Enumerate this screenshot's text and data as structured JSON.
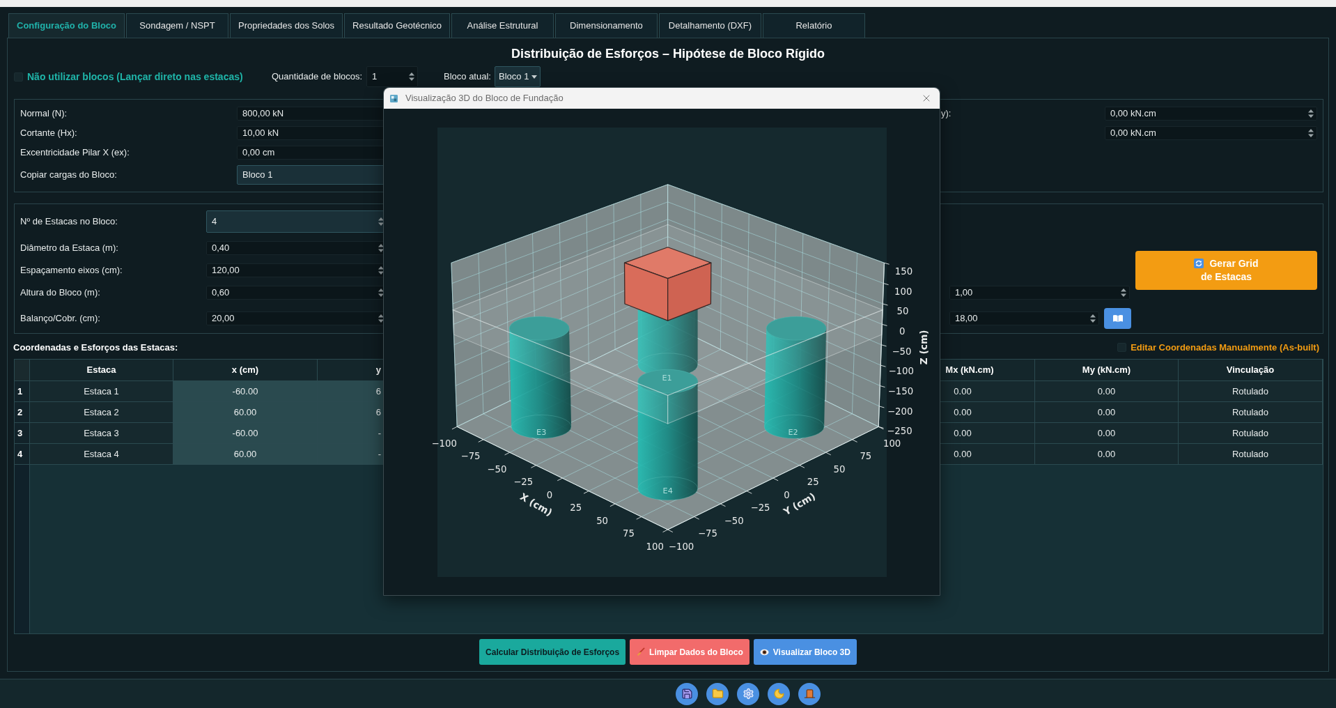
{
  "tabs": [
    {
      "label": "Configuração do Bloco",
      "selected": true
    },
    {
      "label": "Sondagem / NSPT",
      "selected": false
    },
    {
      "label": "Propriedades dos Solos",
      "selected": false
    },
    {
      "label": "Resultado Geotécnico",
      "selected": false
    },
    {
      "label": "Análise Estrutural",
      "selected": false
    },
    {
      "label": "Dimensionamento",
      "selected": false
    },
    {
      "label": "Detalhamento (DXF)",
      "selected": false
    },
    {
      "label": "Relatório",
      "selected": false
    }
  ],
  "page_title": "Distribuição de Esforços – Hipótese de Bloco Rígido",
  "block_options": {
    "no_blocks": {
      "label": "Não utilizar blocos (Lançar direto nas estacas)",
      "checked": false
    },
    "block_count": {
      "label": "Quantidade de blocos:",
      "value": "1"
    },
    "current_block": {
      "label": "Bloco atual:",
      "value": "Bloco 1"
    }
  },
  "viewer": {
    "title": "Visualização 3D do Bloco de Fundação",
    "x_ticks": [
      "−100",
      "−75",
      "−50",
      "−25",
      "0",
      "25",
      "50",
      "75",
      "100"
    ],
    "y_ticks": [
      "−100",
      "−75",
      "−50",
      "−25",
      "0",
      "25",
      "50",
      "75",
      "100"
    ],
    "z_ticks": [
      "150",
      "100",
      "50",
      "0",
      "−50",
      "−100",
      "−150",
      "−200",
      "−250"
    ],
    "x_label": "X (cm)",
    "y_label": "Y (cm)",
    "z_label": "Z (cm)",
    "pile_labels": [
      "E1",
      "E2",
      "E3",
      "E4"
    ]
  },
  "loads": {
    "left": [
      {
        "kind": "spin",
        "label": "Normal (N):",
        "value": "800,00 kN"
      },
      {
        "kind": "spin",
        "label": "Cortante (Hx):",
        "value": "10,00 kN"
      },
      {
        "kind": "spin",
        "label": "Excentricidade Pilar X (ex):",
        "value": "0,00 cm"
      },
      {
        "kind": "combo",
        "label": "Copiar cargas do Bloco:",
        "value": "Bloco 1"
      }
    ],
    "right": [
      {
        "label": "y):",
        "value": "0,00 kN.cm"
      },
      {
        "value": "0,00 kN.cm"
      }
    ]
  },
  "piles": {
    "fields": [
      {
        "label": "Nº de Estacas no Bloco:",
        "value": "4",
        "focused": true
      },
      {
        "label": "Diâmetro da Estaca (m):",
        "value": "0,40",
        "focused": false
      },
      {
        "label": "Espaçamento eixos (cm):",
        "value": "120,00",
        "focused": false
      },
      {
        "label": "Altura do Bloco (m):",
        "value": "0,60",
        "focused": false
      },
      {
        "label": "Balanço/Cobr. (cm):",
        "value": "20,00",
        "focused": false
      }
    ],
    "side_fields": [
      {
        "value": "1,00"
      },
      {
        "value": "18,00"
      }
    ],
    "generate_button": {
      "label": "Gerar Grid\nde Estacas"
    }
  },
  "table_title": "Coordenadas e Esforços das Estacas:",
  "manual_edit": {
    "label": "Editar Coordenadas Manualmente (As-built)",
    "checked": false
  },
  "table": {
    "columns": [
      {
        "label": "Estaca",
        "highlighted": false
      },
      {
        "label": "x (cm)",
        "highlighted": true
      },
      {
        "label": "y",
        "highlighted": true
      },
      {
        "label": "Mx (kN.cm)",
        "highlighted": false
      },
      {
        "label": "My (kN.cm)",
        "highlighted": false
      },
      {
        "label": "Vinculação",
        "highlighted": false
      }
    ],
    "rows": [
      {
        "number": "1",
        "cells": [
          "Estaca 1",
          "-60.00",
          "6",
          "0.00",
          "0.00",
          "Rotulado"
        ]
      },
      {
        "number": "2",
        "cells": [
          "Estaca 2",
          "60.00",
          "6",
          "0.00",
          "0.00",
          "Rotulado"
        ]
      },
      {
        "number": "3",
        "cells": [
          "Estaca 3",
          "-60.00",
          "-",
          "0.00",
          "0.00",
          "Rotulado"
        ]
      },
      {
        "number": "4",
        "cells": [
          "Estaca 4",
          "60.00",
          "-",
          "0.00",
          "0.00",
          "Rotulado"
        ]
      }
    ]
  },
  "actions": [
    {
      "kind": "calculate",
      "label": "Calcular Distribuição de Esforços"
    },
    {
      "kind": "clear",
      "label": "Limpar Dados do Bloco"
    },
    {
      "kind": "view3d",
      "label": "Visualizar Bloco 3D"
    }
  ],
  "toolbar": [
    {
      "kind": "save"
    },
    {
      "kind": "open"
    },
    {
      "kind": "settings"
    },
    {
      "kind": "theme"
    },
    {
      "kind": "exit"
    }
  ]
}
